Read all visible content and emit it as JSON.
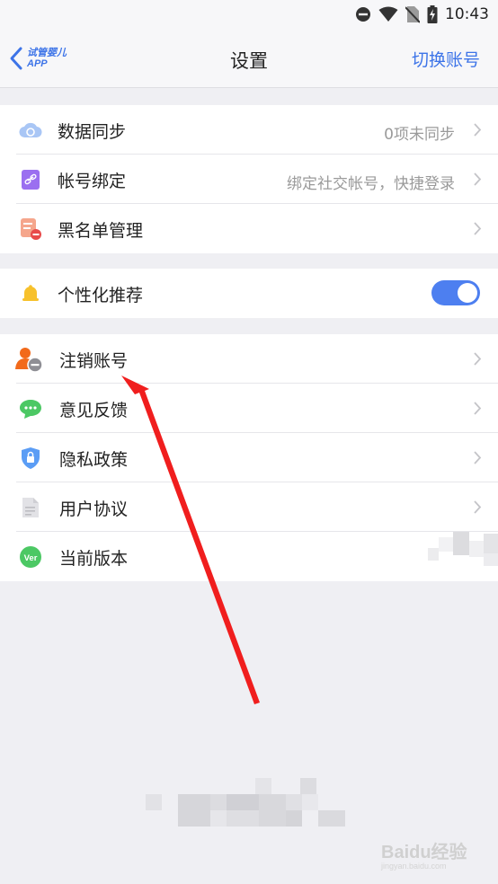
{
  "status_bar": {
    "time": "10:43",
    "icons": [
      "do-not-disturb-icon",
      "wifi-icon",
      "no-sim-icon",
      "battery-charging-icon"
    ]
  },
  "header": {
    "back_label_line1": "试管婴儿",
    "back_label_line2": "APP",
    "title": "设置",
    "right_action": "切换账号"
  },
  "group1": {
    "items": [
      {
        "label": "数据同步",
        "value": "0项未同步",
        "icon": "cloud-sync-icon"
      },
      {
        "label": "帐号绑定",
        "value": "绑定社交帐号，快捷登录",
        "icon": "link-icon"
      },
      {
        "label": "黑名单管理",
        "value": "",
        "icon": "blacklist-icon"
      }
    ]
  },
  "group2": {
    "items": [
      {
        "label": "个性化推荐",
        "icon": "bell-icon",
        "toggle": true
      }
    ]
  },
  "group3": {
    "items": [
      {
        "label": "注销账号",
        "icon": "account-remove-icon"
      },
      {
        "label": "意见反馈",
        "icon": "chat-bubble-icon"
      },
      {
        "label": "隐私政策",
        "icon": "shield-lock-icon"
      },
      {
        "label": "用户协议",
        "icon": "document-icon"
      },
      {
        "label": "当前版本",
        "icon": "version-icon",
        "badge": "Ver"
      }
    ]
  },
  "colors": {
    "accent": "#3d74e8",
    "annotation_arrow": "#f01e1e",
    "background": "#efeff3"
  },
  "watermark": {
    "brand": "Baidu经验",
    "url": "jingyan.baidu.com"
  }
}
